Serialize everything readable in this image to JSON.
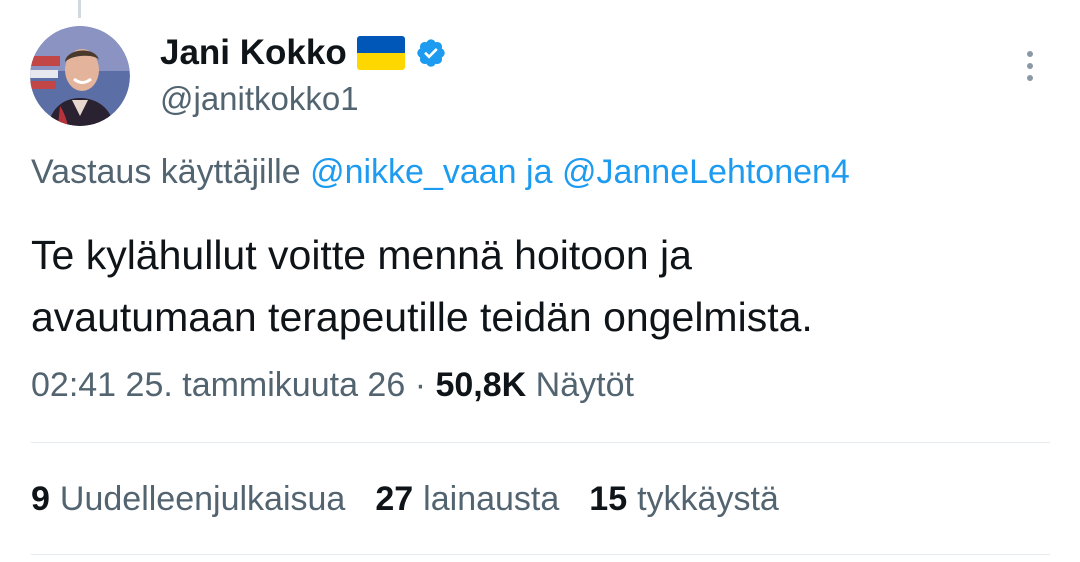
{
  "author": {
    "name": "Jani Kokko",
    "handle": "@janitkokko1",
    "flag_icon": "ukraine-flag-icon",
    "verified_icon": "verified-badge-icon",
    "verified_color": "#1d9bf0"
  },
  "reply_context": {
    "prefix": "Vastaus käyttäjille",
    "mention1": "@nikke_vaan",
    "conjunction": "ja",
    "mention2": "@JanneLehtonen4"
  },
  "tweet": {
    "line1": "Te kylähullut voitte mennä hoitoon ja",
    "line2": "avautumaan terapeutille teidän ongelmista."
  },
  "meta": {
    "time": "02:41",
    "date": "25. tammikuuta 26",
    "separator": "·",
    "views_count": "50,8K",
    "views_label": "Näytöt"
  },
  "stats": {
    "retweets_count": "9",
    "retweets_label": "Uudelleenjulkaisua",
    "quotes_count": "27",
    "quotes_label": "lainausta",
    "likes_count": "15",
    "likes_label": "tykkäystä"
  },
  "more_icon": "more-vertical-icon"
}
